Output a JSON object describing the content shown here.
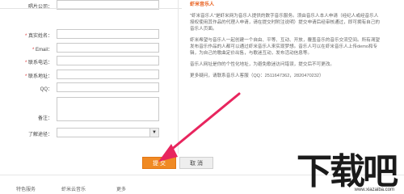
{
  "form": {
    "top_field": {
      "label": "唱片公司："
    },
    "fields": [
      {
        "label": "真实姓名：",
        "required": true
      },
      {
        "label": "Email：",
        "required": true
      },
      {
        "label": "联系电话：",
        "required": true
      },
      {
        "label": "联系地址：",
        "required": true
      },
      {
        "label": "QQ：",
        "required": false
      }
    ],
    "remark_label": "备注：",
    "source_label": "了解途径：",
    "source_value": ""
  },
  "sidebar": {
    "title": "虾米音乐人",
    "paragraphs": [
      "\"虾米音乐人\"是虾米网为音乐人提供的数字音乐服务。须由音乐人本人申请（经纪人或经音乐人授权使用其作品的代理人申请，请在提交时附注说明）提交申请后经审核通过，即可拥有自己的音乐人页面。",
      "虾米希望与音乐人一起创建一个自由、平等、互动、开放，覆盖音乐的音乐交流空间。所有渴望发布音乐作品的人都可以通过虾米音乐人来实现梦想。音乐人可以在虾米音乐人上传demo和专辑，为自己的歌曲定价出售，与歌迷互动，发布活动信息等。",
      "音乐人网址是你的个性化地址，为避免歌迷访问错误，提交后不可更改。",
      "更多疑问，请联系音乐人客服（QQ：2511647362，2820470232）"
    ]
  },
  "buttons": {
    "submit": "提 交",
    "cancel": "取 消"
  },
  "footer": {
    "links": [
      "特色服务",
      "虾米云音乐",
      "更多"
    ]
  },
  "watermark": {
    "big": "下载吧",
    "small": "www.xiazaiba.com"
  },
  "colors": {
    "accent": "#f08a24",
    "arrow": "#e8255e",
    "title": "#e85d1a"
  }
}
